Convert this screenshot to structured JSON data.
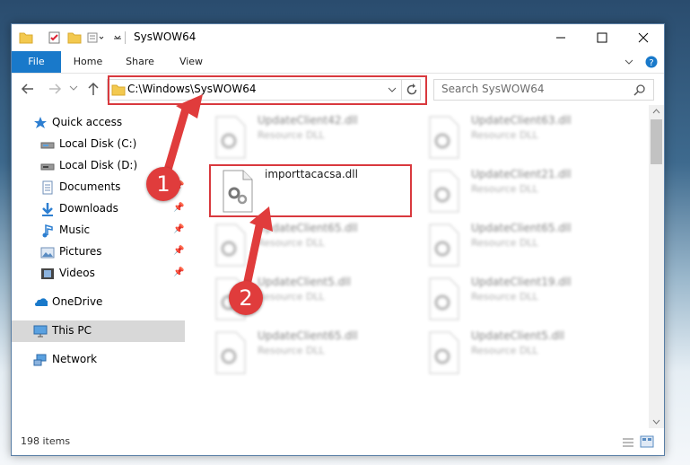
{
  "window": {
    "title": "SysWOW64"
  },
  "ribbon": {
    "tabs": [
      {
        "label": "File"
      },
      {
        "label": "Home"
      },
      {
        "label": "Share"
      },
      {
        "label": "View"
      }
    ]
  },
  "address": {
    "path": "C:\\Windows\\SysWOW64"
  },
  "search": {
    "placeholder": "Search SysWOW64"
  },
  "sidebar": {
    "items": [
      {
        "label": "Quick access",
        "icon": "star-icon"
      },
      {
        "label": "Local Disk (C:)",
        "icon": "drive-icon"
      },
      {
        "label": "Local Disk (D:)",
        "icon": "drive-icon"
      },
      {
        "label": "Documents",
        "icon": "documents-icon"
      },
      {
        "label": "Downloads",
        "icon": "download-icon"
      },
      {
        "label": "Music",
        "icon": "music-icon"
      },
      {
        "label": "Pictures",
        "icon": "pictures-icon"
      },
      {
        "label": "Videos",
        "icon": "videos-icon"
      },
      {
        "label": "OneDrive",
        "icon": "cloud-icon"
      },
      {
        "label": "This PC",
        "icon": "computer-icon"
      },
      {
        "label": "Network",
        "icon": "network-icon"
      }
    ]
  },
  "files": [
    {
      "name": "UpdateClient42.dll",
      "type": "Resource DLL"
    },
    {
      "name": "UpdateClient63.dll",
      "type": "Resource DLL"
    },
    {
      "name": "importtacacsa.dll",
      "type": ""
    },
    {
      "name": "UpdateClient21.dll",
      "type": "Resource DLL"
    },
    {
      "name": "UpdateClient65.dll",
      "type": "Resource DLL"
    },
    {
      "name": "UpdateClient65.dll",
      "type": "Resource DLL"
    },
    {
      "name": "UpdateClient5.dll",
      "type": "Resource DLL"
    },
    {
      "name": "UpdateClient19.dll",
      "type": "Resource DLL"
    },
    {
      "name": "UpdateClient65.dll",
      "type": "Resource DLL"
    },
    {
      "name": "UpdateClient5.dll",
      "type": "Resource DLL"
    }
  ],
  "status": {
    "count": "198 items"
  },
  "annotations": {
    "step1": "1",
    "step2": "2"
  },
  "colors": {
    "accent": "#1979ca",
    "highlight": "#d9393e"
  }
}
